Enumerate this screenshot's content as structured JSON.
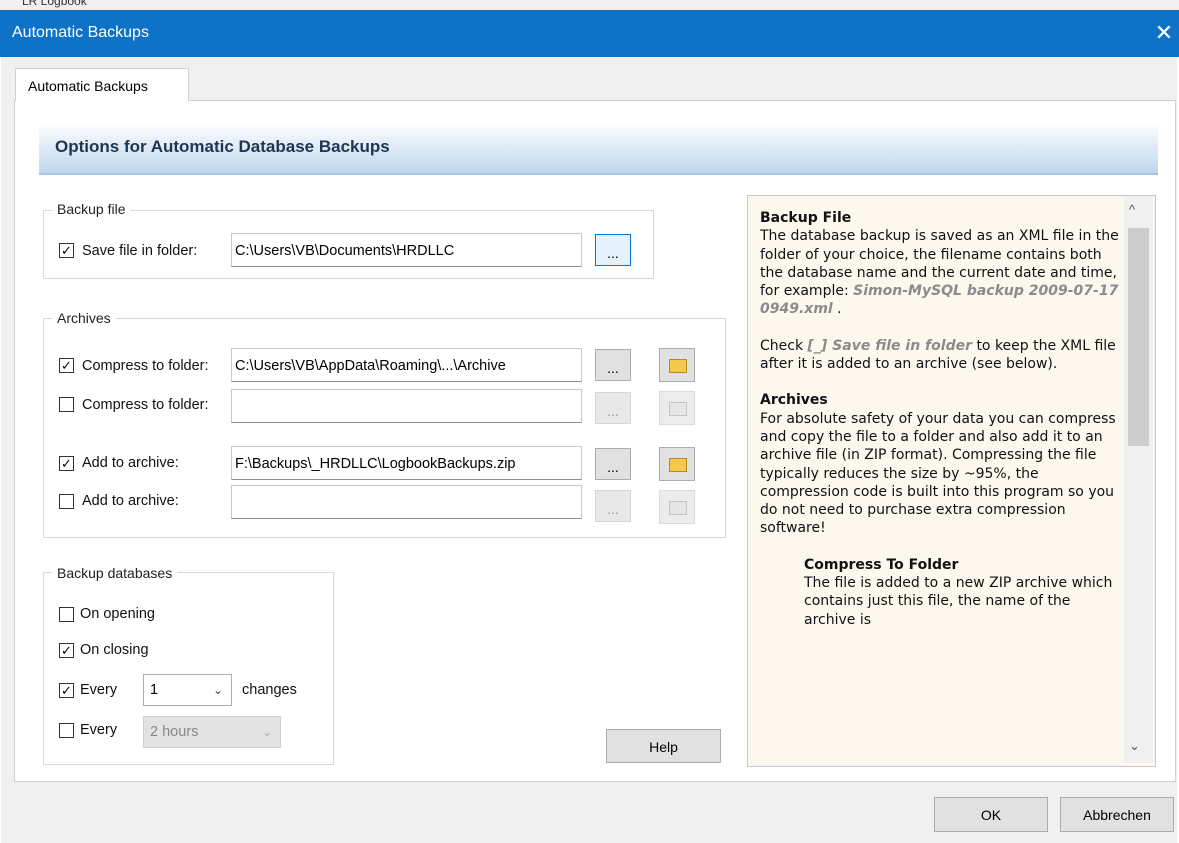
{
  "window": {
    "title": "Automatic Backups",
    "close_glyph": "✕",
    "behind_fragment": "LR Logbook"
  },
  "tab": {
    "label": "Automatic Backups"
  },
  "header": {
    "title": "Options for Automatic Database Backups"
  },
  "backup_file": {
    "group_label": "Backup file",
    "save_label": "Save file in folder:",
    "save_checked": true,
    "save_path": "C:\\Users\\VB\\Documents\\HRDLLC",
    "browse_label": "..."
  },
  "archives": {
    "group_label": "Archives",
    "rows": [
      {
        "label": "Compress to folder:",
        "checked": true,
        "path": "C:\\Users\\VB\\AppData\\Roaming\\...\\Archive",
        "enabled": true
      },
      {
        "label": "Compress to folder:",
        "checked": false,
        "path": "",
        "enabled": false
      },
      {
        "label": "Add to archive:",
        "checked": true,
        "path": "F:\\Backups\\_HRDLLC\\LogbookBackups.zip",
        "enabled": true
      },
      {
        "label": "Add to archive:",
        "checked": false,
        "path": "",
        "enabled": false
      }
    ],
    "browse_label": "..."
  },
  "backup_databases": {
    "group_label": "Backup databases",
    "on_opening": {
      "label": "On opening",
      "checked": false
    },
    "on_closing": {
      "label": "On closing",
      "checked": true
    },
    "every_changes": {
      "label": "Every",
      "checked": true,
      "value": "1",
      "suffix": "changes"
    },
    "every_hours": {
      "label": "Every",
      "checked": false,
      "value": "2 hours"
    }
  },
  "buttons": {
    "help": "Help",
    "ok": "OK",
    "cancel": "Abbrechen"
  },
  "help": {
    "h1": "Backup File",
    "p1": "The database backup is saved as an XML file in the folder of your choice, the filename contains both the database name and the current date and time, for example:",
    "p1_example": "Simon-MySQL backup 2009-07-17 0949.xml",
    "p1_end": ".",
    "p2_pre": "Check",
    "p2_em": "[_] Save file in folder",
    "p2_post": "to keep the XML file after it is added to an archive (see below).",
    "h2": "Archives",
    "p3": "For absolute safety of your data you can compress and copy the file to a folder and also add it to an archive file (in ZIP format). Compressing the file typically reduces the size by ~95%, the compression code is built into this program so you do not need to purchase extra compression software!",
    "h3": "Compress To Folder",
    "p4": "The file is added to a new ZIP archive which contains just this file, the name of the archive is"
  },
  "icons": {
    "checkmark": "✓",
    "chevron_down": "⌄",
    "scroll_up": "^",
    "scroll_down": "⌄"
  }
}
